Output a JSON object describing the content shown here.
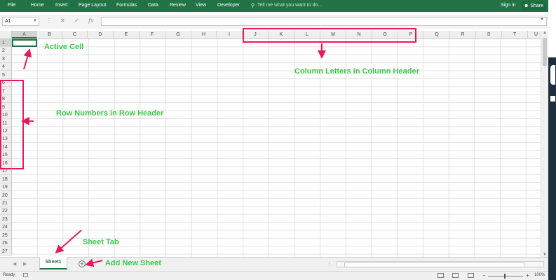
{
  "ribbon": {
    "tabs": [
      "File",
      "Home",
      "Insert",
      "Page Layout",
      "Formulas",
      "Data",
      "Review",
      "View",
      "Developer"
    ],
    "tell_me": "Tell me what you want to do...",
    "sign_in": "Sign in",
    "share": "Share",
    "color": "#217346"
  },
  "formula_bar": {
    "name_box": "A1",
    "fx": "fx",
    "formula": ""
  },
  "columns": [
    "A",
    "B",
    "C",
    "D",
    "E",
    "F",
    "G",
    "H",
    "I",
    "J",
    "K",
    "L",
    "M",
    "N",
    "O",
    "P",
    "Q",
    "R",
    "S",
    "T",
    "U"
  ],
  "rows": [
    "1",
    "2",
    "3",
    "4",
    "5",
    "6",
    "7",
    "8",
    "9",
    "10",
    "11",
    "12",
    "13",
    "14",
    "15",
    "16",
    "17",
    "18",
    "19",
    "20",
    "21",
    "22",
    "23",
    "24",
    "25",
    "26",
    "27"
  ],
  "active_cell": "A1",
  "sheet_tabs": [
    "Sheet1"
  ],
  "status_bar": {
    "ready": "Ready",
    "zoom": "100%"
  },
  "annotations": {
    "active_cell": "Active Cell",
    "column_letters": "Column Letters in Column Header",
    "row_numbers": "Row Numbers in Row Header",
    "sheet_tab": "Sheet Tab",
    "add_new_sheet": "Add New Sheet",
    "highlight_color": "#e8195b",
    "label_color": "#3ec94a"
  }
}
